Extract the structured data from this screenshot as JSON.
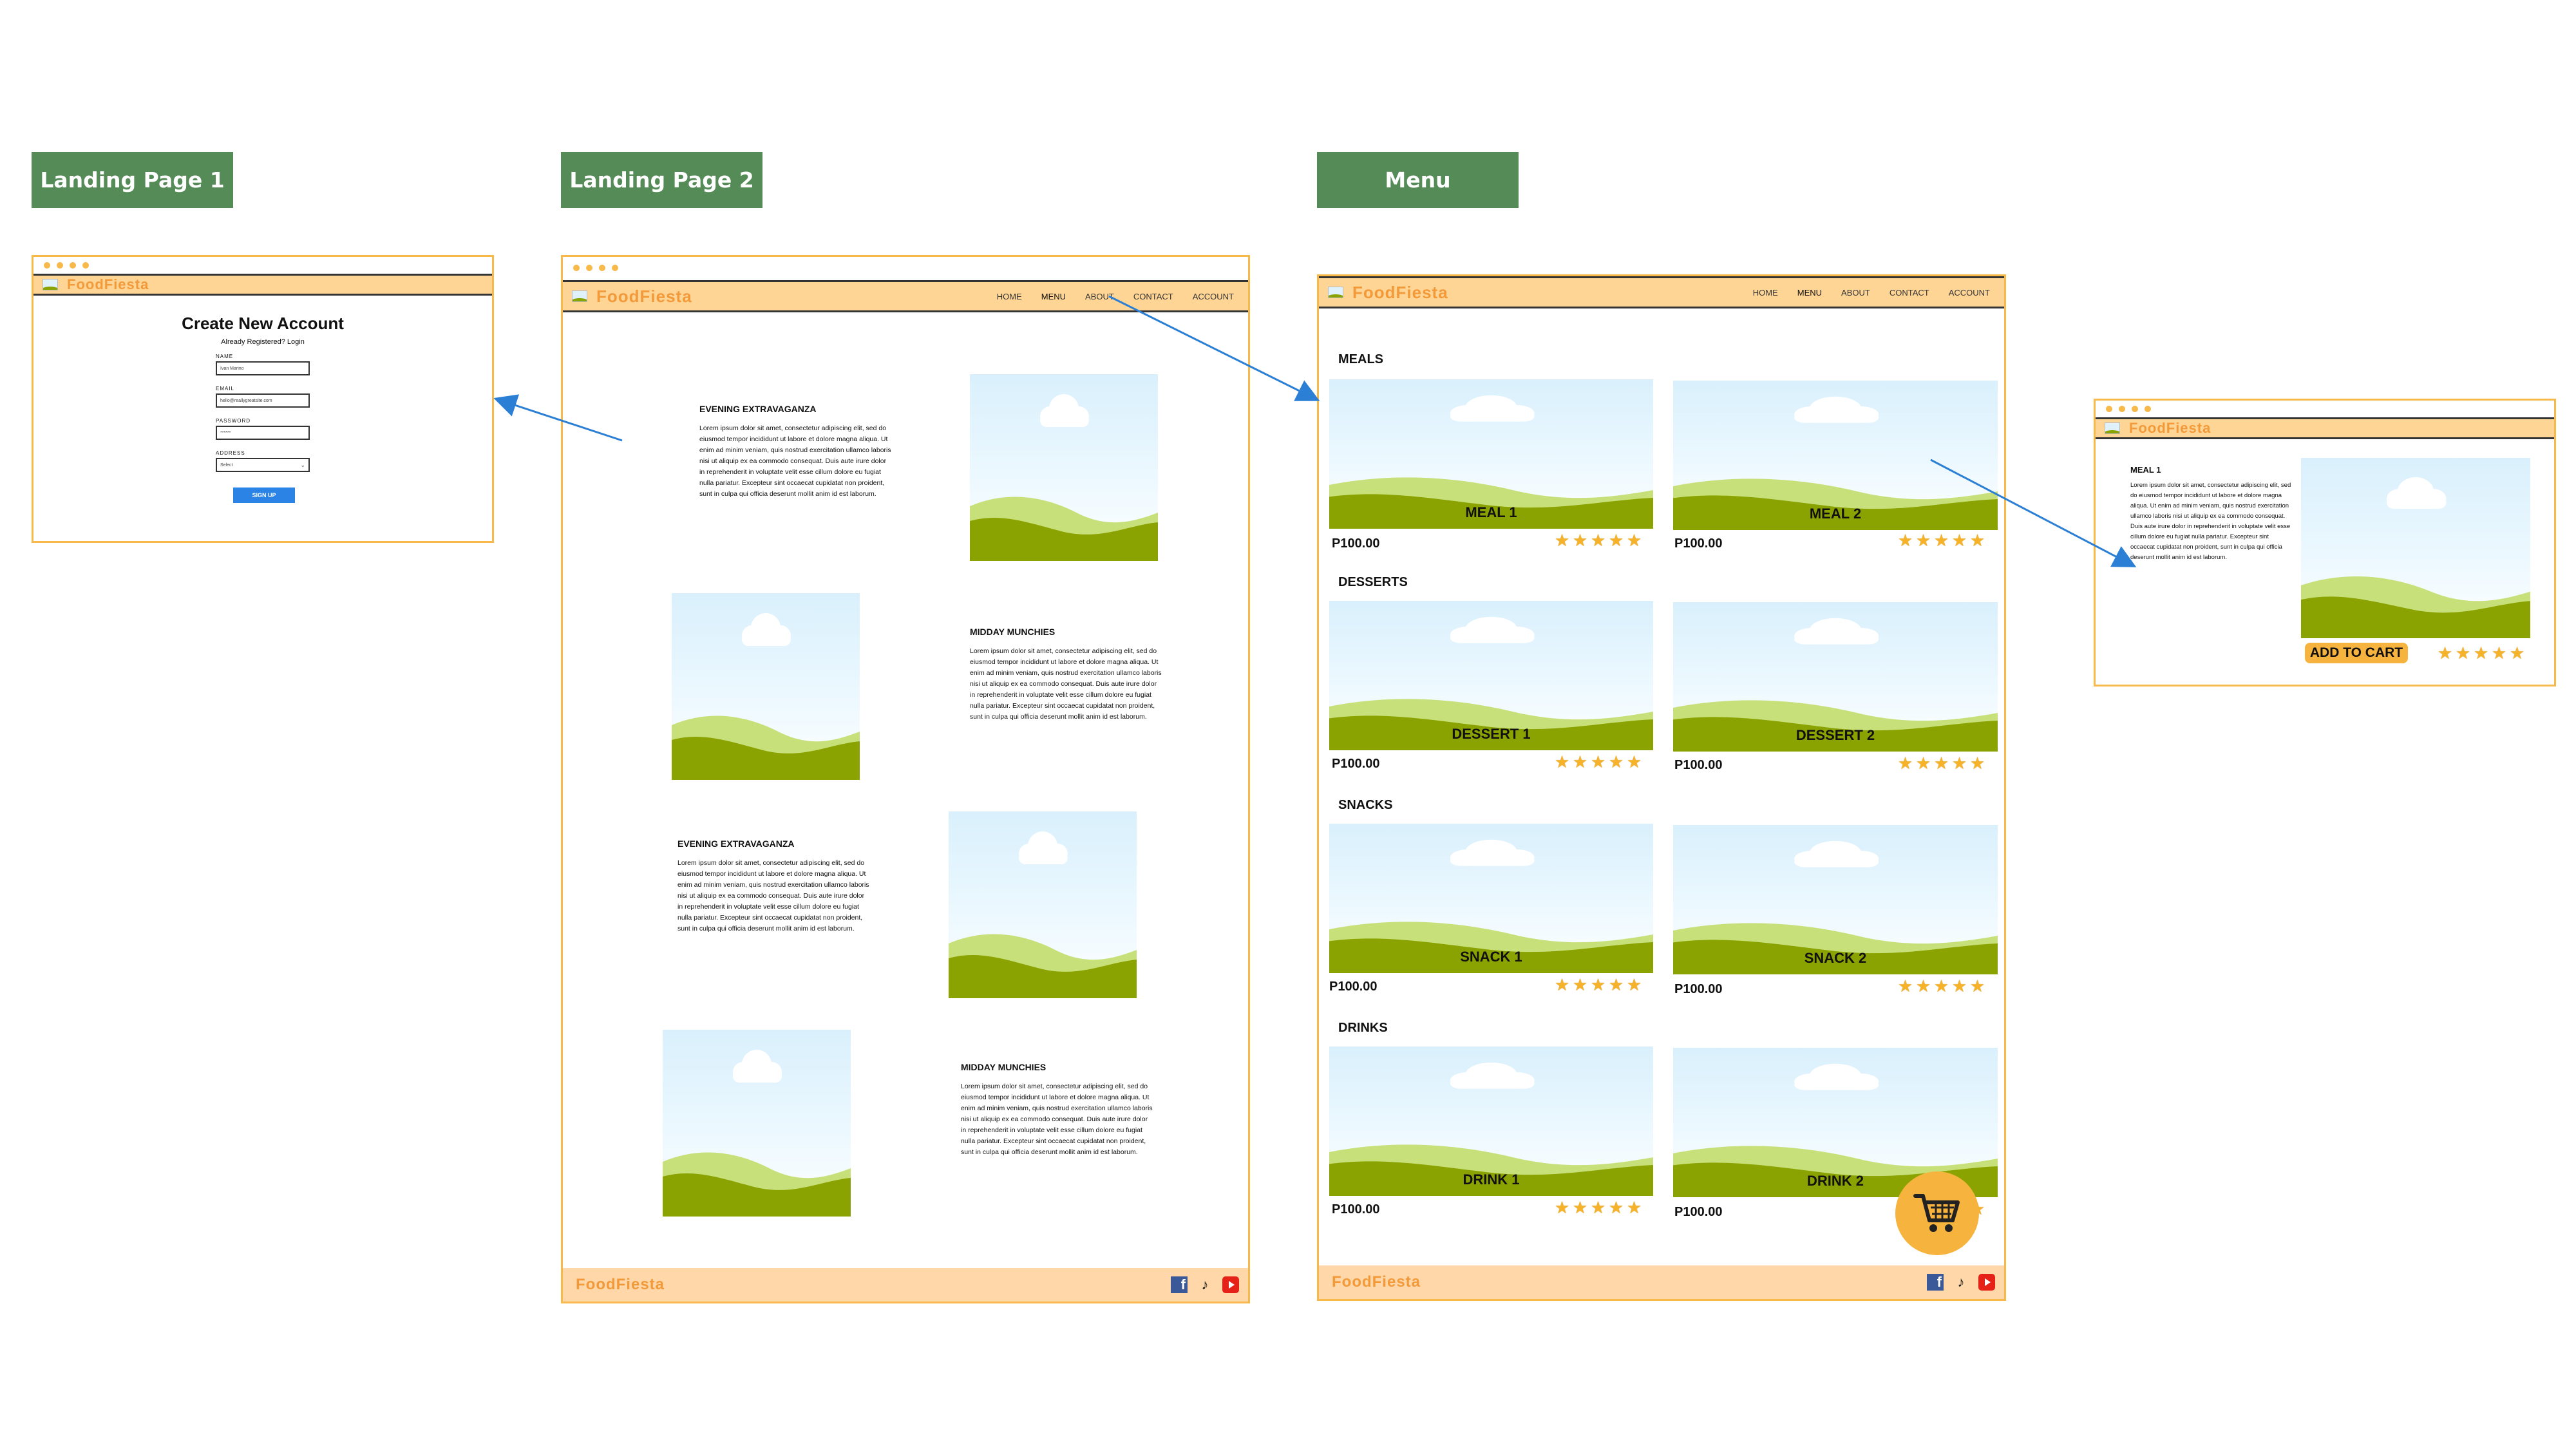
{
  "labels": {
    "landing1": "Landing Page 1",
    "landing2": "Landing Page 2",
    "menu": "Menu"
  },
  "brand": "FoodFiesta",
  "nav": [
    "HOME",
    "MENU",
    "ABOUT",
    "CONTACT",
    "ACCOUNT"
  ],
  "signup_form": {
    "title": "Create New Account",
    "subtitle": "Already Registered? Login",
    "name_label": "NAME",
    "name_value": "Ivan Marino",
    "email_label": "EMAIL",
    "email_value": "hello@reallygreatsite.com",
    "password_label": "PASSWORD",
    "password_value": "******",
    "address_label": "ADDRESS",
    "address_value": "Select",
    "button": "SIGN UP"
  },
  "landing2": {
    "sections": [
      {
        "heading": "EVENING EXTRAVAGANZA",
        "body": "Lorem ipsum dolor sit amet, consectetur adipiscing elit, sed do eiusmod tempor incididunt ut labore et dolore magna aliqua. Ut enim ad minim veniam, quis nostrud exercitation ullamco laboris nisi ut aliquip ex ea commodo consequat. Duis aute irure dolor in reprehenderit in voluptate velit esse cillum dolore eu fugiat nulla pariatur. Excepteur sint occaecat cupidatat non proident, sunt in culpa qui officia deserunt mollit anim id est laborum."
      },
      {
        "heading": "MIDDAY MUNCHIES",
        "body": "Lorem ipsum dolor sit amet, consectetur adipiscing elit, sed do eiusmod tempor incididunt ut labore et dolore magna aliqua. Ut enim ad minim veniam, quis nostrud exercitation ullamco laboris nisi ut aliquip ex ea commodo consequat. Duis aute irure dolor in reprehenderit in voluptate velit esse cillum dolore eu fugiat nulla pariatur. Excepteur sint occaecat cupidatat non proident, sunt in culpa qui officia deserunt mollit anim id est laborum."
      },
      {
        "heading": "EVENING EXTRAVAGANZA",
        "body": "Lorem ipsum dolor sit amet, consectetur adipiscing elit, sed do eiusmod tempor incididunt ut labore et dolore magna aliqua. Ut enim ad minim veniam, quis nostrud exercitation ullamco laboris nisi ut aliquip ex ea commodo consequat. Duis aute irure dolor in reprehenderit in voluptate velit esse cillum dolore eu fugiat nulla pariatur. Excepteur sint occaecat cupidatat non proident, sunt in culpa qui officia deserunt mollit anim id est laborum."
      },
      {
        "heading": "MIDDAY MUNCHIES",
        "body": "Lorem ipsum dolor sit amet, consectetur adipiscing elit, sed do eiusmod tempor incididunt ut labore et dolore magna aliqua. Ut enim ad minim veniam, quis nostrud exercitation ullamco laboris nisi ut aliquip ex ea commodo consequat. Duis aute irure dolor in reprehenderit in voluptate velit esse cillum dolore eu fugiat nulla pariatur. Excepteur sint occaecat cupidatat non proident, sunt in culpa qui officia deserunt mollit anim id est laborum."
      }
    ]
  },
  "menu": {
    "categories": [
      {
        "title": "MEALS",
        "items": [
          {
            "name": "MEAL 1",
            "price": "P100.00"
          },
          {
            "name": "MEAL 2",
            "price": "P100.00"
          }
        ]
      },
      {
        "title": "DESSERTS",
        "items": [
          {
            "name": "DESSERT 1",
            "price": "P100.00"
          },
          {
            "name": "DESSERT 2",
            "price": "P100.00"
          }
        ]
      },
      {
        "title": "SNACKS",
        "items": [
          {
            "name": "SNACK 1",
            "price": "P100.00"
          },
          {
            "name": "SNACK 2",
            "price": "P100.00"
          }
        ]
      },
      {
        "title": "DRINKS",
        "items": [
          {
            "name": "DRINK 1",
            "price": "P100.00"
          },
          {
            "name": "DRINK 2",
            "price": "P100.00"
          }
        ]
      }
    ],
    "rating_stars": 5
  },
  "detail": {
    "title": "MEAL 1",
    "body": "Lorem ipsum dolor sit amet, consectetur adipiscing elit, sed do eiusmod tempor incididunt ut labore et dolore magna aliqua. Ut enim ad minim veniam, quis nostrud exercitation ullamco laboris nisi ut aliquip ex ea commodo consequat. Duis aute irure dolor in reprehenderit in voluptate velit esse cillum dolore eu fugiat nulla pariatur. Excepteur sint occaecat cupidatat non proident, sunt in culpa qui officia deserunt mollit anim id est laborum.",
    "add_to_cart": "ADD TO CART",
    "rating_stars": 5
  },
  "icons": {
    "facebook": "facebook-icon",
    "tiktok": "tiktok-icon",
    "youtube": "youtube-icon",
    "cart": "cart-icon",
    "logo": "landscape-logo-icon"
  },
  "colors": {
    "label_bg": "#558b57",
    "frame_border": "#f7b94a",
    "header_bg": "#ffd595",
    "footer_bg": "#ffd7a8",
    "brand": "#f29a3a",
    "button_blue": "#2b83e6",
    "accent_orange": "#f6b33d",
    "arrow": "#2b7fd4"
  }
}
